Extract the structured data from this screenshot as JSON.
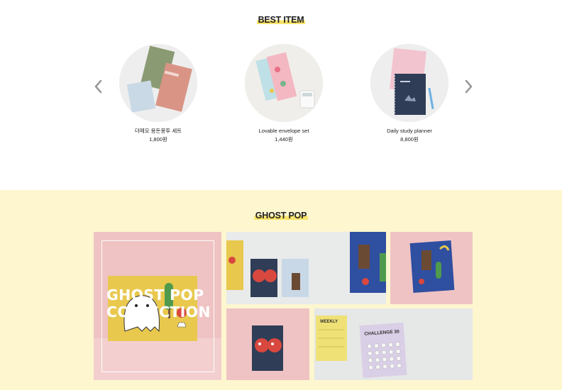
{
  "best_item": {
    "title": "BEST ITEM",
    "prev_icon": "chevron-left-icon",
    "next_icon": "chevron-right-icon",
    "products": [
      {
        "name": "더메모 용돈봉투 세트",
        "price": "1,800원"
      },
      {
        "name": "Lovable envelope set",
        "price": "1,440원"
      },
      {
        "name": "Daily study planner",
        "price": "8,800원"
      }
    ]
  },
  "ghost_pop": {
    "title": "GHOST POP",
    "collection_label": "GHOST POP COLLECTION",
    "images_text": {
      "notebook_weekly": "WEEKLY",
      "notebook_challenge": "CHALLENGE 30"
    }
  },
  "colors": {
    "accent_highlight": "#f7e36a",
    "section_bg": "#fdf6cf",
    "pink_bg": "#f0c4c4"
  }
}
